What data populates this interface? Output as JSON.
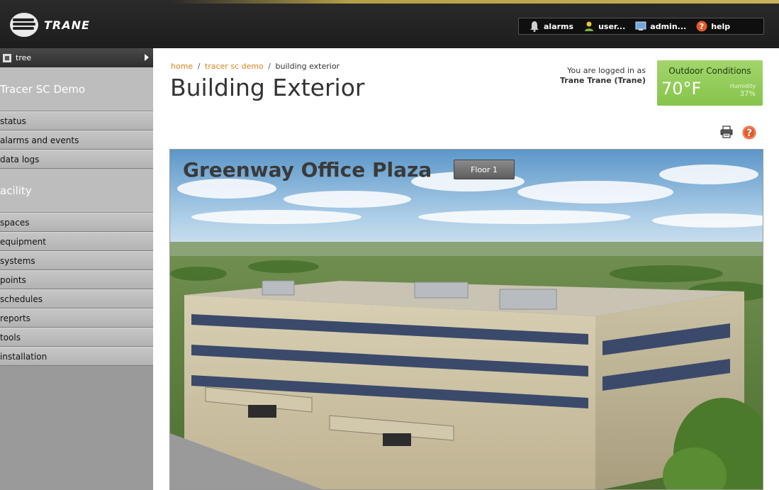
{
  "header": {
    "logo_text": "TRANE",
    "toolbar": {
      "alarms_label": "alarms",
      "user_label": "user...",
      "admin_label": "admin...",
      "help_label": "help"
    }
  },
  "sidebar": {
    "tree_label": "tree",
    "section1_title": "Tracer SC Demo",
    "section1_items": [
      {
        "label": "status"
      },
      {
        "label": "alarms and events"
      },
      {
        "label": "data logs"
      }
    ],
    "section2_title": "acility",
    "section2_items": [
      {
        "label": "spaces"
      },
      {
        "label": "equipment"
      },
      {
        "label": "systems"
      },
      {
        "label": "points"
      },
      {
        "label": "schedules"
      },
      {
        "label": "reports"
      },
      {
        "label": "tools"
      },
      {
        "label": "installation"
      }
    ]
  },
  "breadcrumb": {
    "home": "home",
    "sep": "/",
    "demo": "tracer sc demo",
    "current": "building exterior"
  },
  "page_title": "Building Exterior",
  "login": {
    "prefix": "You are logged in as",
    "user": "Trane Trane (Trane)"
  },
  "outdoor": {
    "title": "Outdoor Conditions",
    "temperature": "70°F",
    "humidity_label": "Humidity",
    "humidity_value": "37%"
  },
  "graphic": {
    "title": "Greenway Office Plaza",
    "floor_button": "Floor 1"
  },
  "icons": {
    "alarms": "bell-icon",
    "user": "user-icon",
    "admin": "monitor-icon",
    "help": "help-icon",
    "print": "print-icon"
  },
  "colors": {
    "accent_link": "#d9821f",
    "outdoor_green": "#8cc84f",
    "help_red": "#d9401f"
  }
}
